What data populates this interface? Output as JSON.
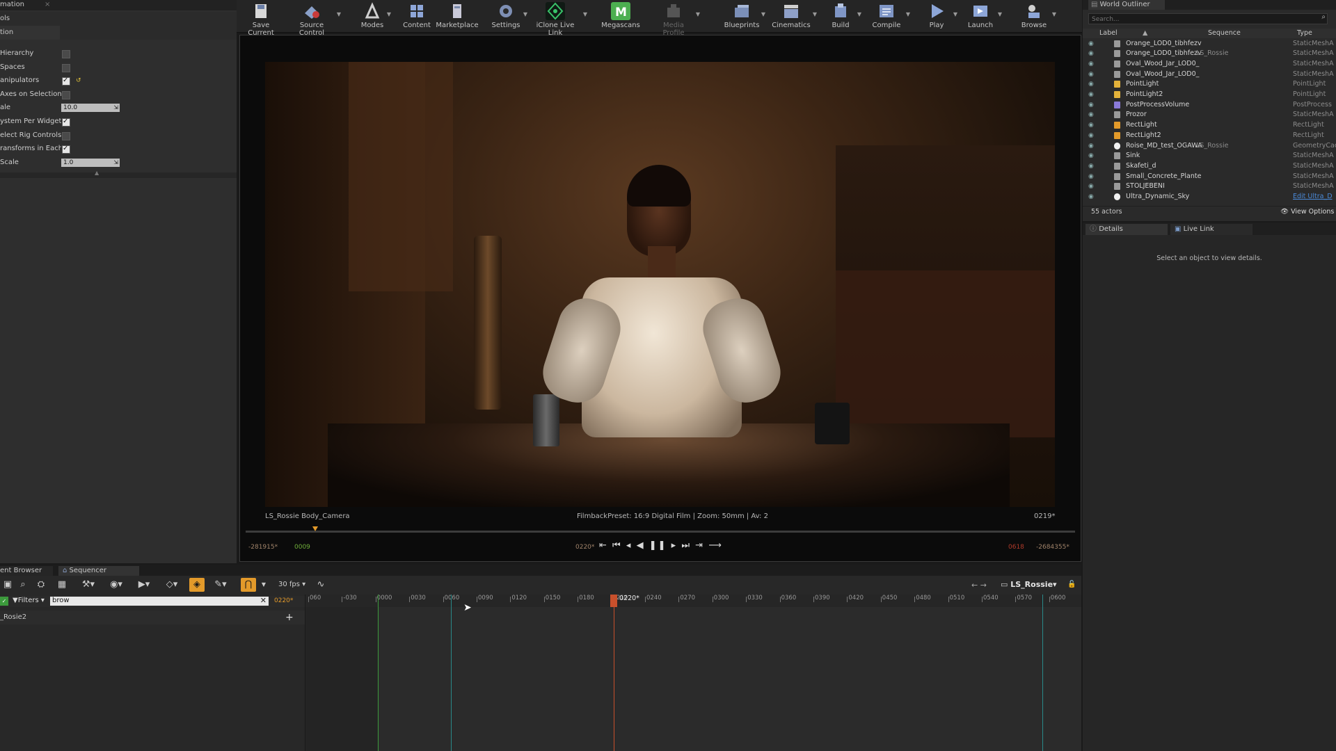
{
  "left_panel": {
    "header_rows": [
      "mation",
      "ols",
      "tion"
    ],
    "rows": [
      {
        "label": "Hierarchy",
        "type": "check",
        "checked": false
      },
      {
        "label": "Spaces",
        "type": "check",
        "checked": false
      },
      {
        "label": "anipulators",
        "type": "check",
        "checked": true
      },
      {
        "label": "Axes on Selection",
        "type": "check",
        "checked": false
      },
      {
        "label": "ale",
        "type": "number",
        "value": "10.0"
      },
      {
        "label": "ystem Per Widget M",
        "type": "check",
        "checked": true
      },
      {
        "label": "elect Rig Controls",
        "type": "check",
        "checked": false
      },
      {
        "label": "ransforms in Each Lc",
        "type": "check",
        "checked": true
      },
      {
        "label": "Scale",
        "type": "number",
        "value": "1.0"
      }
    ]
  },
  "toolbar": {
    "save_current": "Save Current",
    "source_control": "Source Control",
    "modes": "Modes",
    "content": "Content",
    "marketplace": "Marketplace",
    "settings": "Settings",
    "iclone_live_link": "iClone Live Link",
    "megascans": "Megascans",
    "media_profile": "Media Profile",
    "blueprints": "Blueprints",
    "cinematics": "Cinematics",
    "build": "Build",
    "compile": "Compile",
    "play": "Play",
    "launch": "Launch",
    "browse": "Browse"
  },
  "viewport": {
    "camera_label": "LS_Rossie Body_Camera",
    "filmback_info": "FilmbackPreset: 16:9 Digital Film | Zoom: 50mm | Av: 2",
    "frame_right": "0219*",
    "tc_left_start": "-281915*",
    "tc_left_green": "0009",
    "tc_current": "0220*",
    "tc_right_red": "0618",
    "tc_right_end": "-2684355*"
  },
  "outliner": {
    "tab": "World Outliner",
    "search_placeholder": "Search...",
    "col_label": "Label",
    "col_sequence": "Sequence",
    "col_type": "Type",
    "rows": [
      {
        "label": "Orange_LOD0_tibhfezv",
        "sequence": "",
        "type": "StaticMeshA"
      },
      {
        "label": "Orange_LOD0_tibhfezv",
        "sequence": "LS_Rossie",
        "type": "StaticMeshA"
      },
      {
        "label": "Oval_Wood_Jar_LOD0_",
        "sequence": "",
        "type": "StaticMeshA"
      },
      {
        "label": "Oval_Wood_Jar_LOD0_",
        "sequence": "",
        "type": "StaticMeshA"
      },
      {
        "label": "PointLight",
        "sequence": "",
        "type": "PointLight"
      },
      {
        "label": "PointLight2",
        "sequence": "",
        "type": "PointLight"
      },
      {
        "label": "PostProcessVolume",
        "sequence": "",
        "type": "PostProcess"
      },
      {
        "label": "Prozor",
        "sequence": "",
        "type": "StaticMeshA"
      },
      {
        "label": "RectLight",
        "sequence": "",
        "type": "RectLight"
      },
      {
        "label": "RectLight2",
        "sequence": "",
        "type": "RectLight"
      },
      {
        "label": "Roise_MD_test_OGAWA",
        "sequence": "LS_Rossie",
        "type": "GeometryCac"
      },
      {
        "label": "Sink",
        "sequence": "",
        "type": "StaticMeshA"
      },
      {
        "label": "Skafeti_d",
        "sequence": "",
        "type": "StaticMeshA"
      },
      {
        "label": "Small_Concrete_Plante",
        "sequence": "",
        "type": "StaticMeshA"
      },
      {
        "label": "STOLJEBENI",
        "sequence": "",
        "type": "StaticMeshA"
      },
      {
        "label": "Ultra_Dynamic_Sky",
        "sequence": "",
        "type": "Edit Ultra_D"
      }
    ],
    "actor_count": "55 actors",
    "view_options": "View Options"
  },
  "details": {
    "tab_details": "Details",
    "tab_live_link": "Live Link",
    "empty_message": "Select an object to view details."
  },
  "sequencer": {
    "tab_content_browser": "ent Browser",
    "tab_sequencer": "Sequencer",
    "fps": "30 fps",
    "sequence_name": "LS_Rossie",
    "filters": "Filters",
    "search_value": "brow",
    "current_frame_small": "0220*",
    "playhead_label": "0220*",
    "track_name": "_Rosie2",
    "ticks": [
      "060",
      "-030",
      "0000",
      "0030",
      "0060",
      "0090",
      "0120",
      "0150",
      "0180",
      "0210",
      "0240",
      "0270",
      "0300",
      "0330",
      "0360",
      "0390",
      "0420",
      "0450",
      "0480",
      "0510",
      "0540",
      "0570",
      "0600"
    ]
  },
  "colors": {
    "accent_orange": "#e39a2a",
    "playhead_red": "#c8502c",
    "start_green": "#3c9a3c",
    "end_teal": "#2a8a8a"
  }
}
